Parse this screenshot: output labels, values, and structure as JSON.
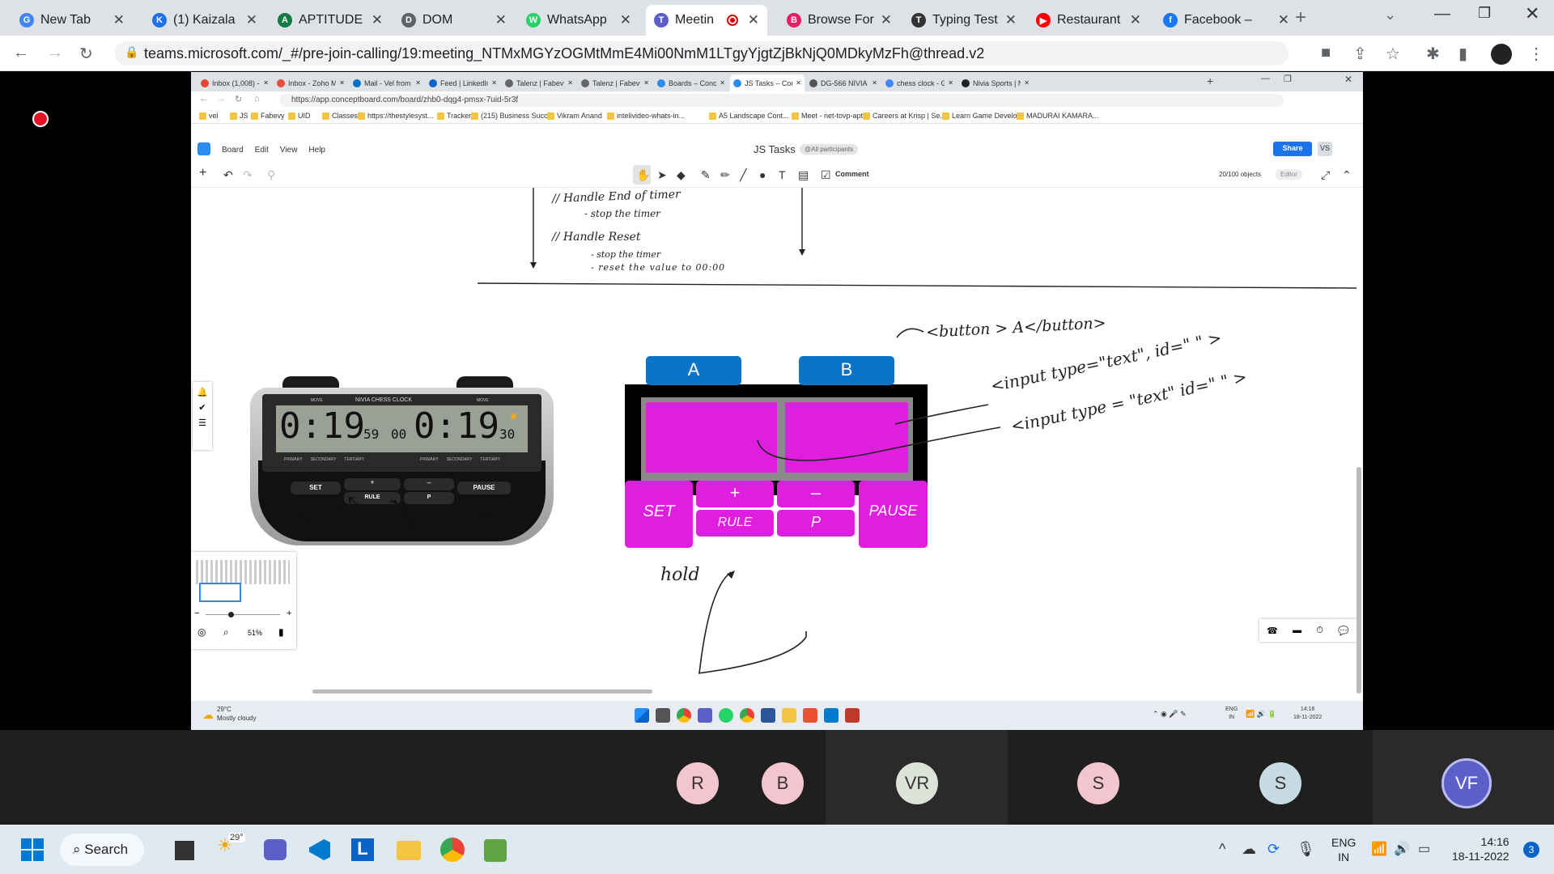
{
  "outer": {
    "tabs": [
      {
        "title": "New Tab",
        "color": "#4285f4",
        "letter": "G"
      },
      {
        "title": "(1) Kaizala",
        "color": "#1f6feb",
        "letter": "K"
      },
      {
        "title": "APTITUDE",
        "color": "#107c41",
        "letter": "A"
      },
      {
        "title": "DOM",
        "color": "#5f6368",
        "letter": "D"
      },
      {
        "title": "WhatsApp",
        "color": "#25d366",
        "letter": "W"
      },
      {
        "title": "Meetin",
        "color": "#5b5fc7",
        "letter": "T"
      },
      {
        "title": "Browse For",
        "color": "#e91e63",
        "letter": "B"
      },
      {
        "title": "Typing Test",
        "color": "#333",
        "letter": "T"
      },
      {
        "title": "Restaurant",
        "color": "#ff0000",
        "letter": "▶"
      },
      {
        "title": "Facebook –",
        "color": "#1877f2",
        "letter": "f"
      }
    ],
    "url": "teams.microsoft.com/_#/pre-join-calling/19:meeting_NTMxMGYzOGMtMmE4Mi00NmM1LTgyYjgtZjBkNjQ0MDkyMzFh@thread.v2",
    "new_tab": "+"
  },
  "inner": {
    "tabs": [
      "Inbox (1,008) - g",
      "Inbox - Zoho M",
      "Mail - Vel from",
      "Feed | LinkedIn",
      "Talenz | Fabevy",
      "Talenz | Fabevy",
      "Boards – Conce",
      "JS Tasks – Conc",
      "DG-566 NIVIA C",
      "chess clock - G",
      "Nivia Sports | N"
    ],
    "url": "https://app.conceptboard.com/board/zhb0-dqg4-pmsx-7uid-5r3f",
    "bookmarks": [
      "vel",
      "JS",
      "Fabevy",
      "UID",
      "Classes",
      "https://thestylesyst...",
      "Tracker",
      "(215) Business Succ...",
      "Vikram Anand",
      "intelivideo-whats-in...",
      "A5 Landscape Cont...",
      "Meet - net-tovp-apt",
      "Careers at Krisp | Se...",
      "Learn Game Develo...",
      "MADURAI KAMARA..."
    ]
  },
  "conceptboard": {
    "menus": [
      "Board",
      "Edit",
      "View",
      "Help"
    ],
    "board_title": "JS Tasks",
    "participants_badge": "@All participants",
    "share_label": "Share",
    "user_initials": "VS",
    "comment_label": "Comment",
    "objects_count": "20/100 objects",
    "editor_label": "Editor",
    "zoom": "51%"
  },
  "board": {
    "notes": {
      "handle_end": "// Handle End of timer",
      "stop_timer": "- stop the timer",
      "handle_reset": "// Handle Reset",
      "stop_timer2": "- stop the timer",
      "reset_value": "- reset the value to 00:00",
      "button_note": "<button > A</button>",
      "input_note1": "<input type=\"text\", id=\" \" >",
      "input_note2": "<input type = \"text\" id=\" \" >",
      "hold": "hold"
    },
    "button_a": "A",
    "button_b": "B",
    "set": "SET",
    "plus": "+",
    "minus": "–",
    "rule": "RULE",
    "p": "P",
    "pause": "PAUSE",
    "clock": {
      "brand": "NIVIA CHESS CLOCK",
      "left_time": "0:19",
      "left_sec": "59",
      "mid": "00",
      "right_time": "0:19",
      "right_sec": "30",
      "btn_set": "SET",
      "btn_rule": "RULE",
      "btn_plus": "+",
      "btn_minus": "–",
      "btn_p": "P",
      "btn_pause": "PAUSE",
      "labels_left": [
        "PRIMARY",
        "SECONDARY",
        "TERTIARY"
      ],
      "labels_right": [
        "PRIMARY",
        "SECONDARY",
        "TERTIARY"
      ],
      "top_left": "MOVE",
      "top_right": "MOVE"
    }
  },
  "inner_taskbar": {
    "weather_temp": "29°C",
    "weather_desc": "Mostly cloudy",
    "lang": "ENG",
    "region": "IN",
    "time": "14:16",
    "date": "18-11-2022"
  },
  "participants": [
    {
      "initials": "R",
      "color": "#f3c6cf"
    },
    {
      "initials": "B",
      "color": "#f3c6cf"
    },
    {
      "initials": "VR",
      "color": "#dde3d8"
    },
    {
      "initials": "S",
      "color": "#f3c6cf"
    },
    {
      "initials": "S",
      "color": "#c7dbe3"
    },
    {
      "initials": "VF",
      "color": "#5b5fc7"
    }
  ],
  "taskbar": {
    "search": "Search",
    "weather_temp": "29°",
    "lang": "ENG",
    "region": "IN",
    "time": "14:16",
    "date": "18-11-2022",
    "notif_count": "3"
  },
  "colors": {
    "magenta": "#e01ee0",
    "blue_btn": "#0a74c9",
    "teams": "#5b5fc7"
  }
}
